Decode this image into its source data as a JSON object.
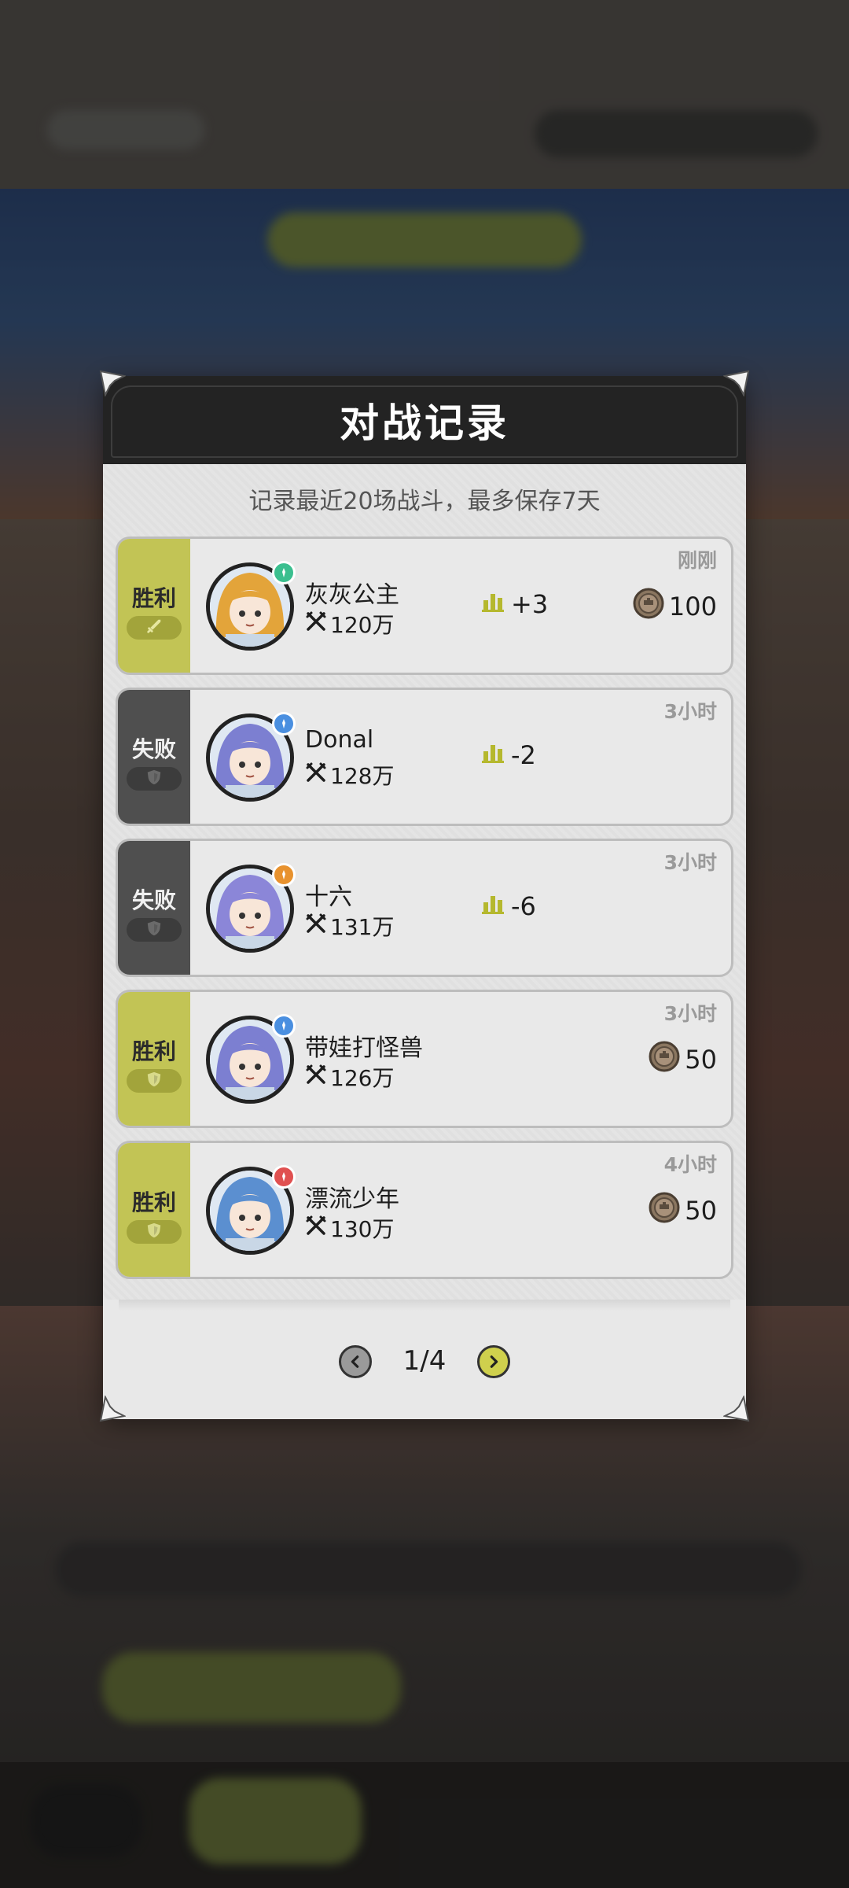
{
  "dialog": {
    "title": "对战记录",
    "subtitle": "记录最近20场战斗，最多保存7天"
  },
  "records": [
    {
      "result": "胜利",
      "outcome": "win",
      "icon": "sword-icon",
      "name": "灰灰公主",
      "power": "120万",
      "time": "刚刚",
      "rank_delta": "+3",
      "coins": "100",
      "avatar_color": "#e3a43a",
      "badge_color": "#3bbf8f"
    },
    {
      "result": "失败",
      "outcome": "lose",
      "icon": "shield-icon",
      "name": "Donal",
      "power": "128万",
      "time": "3小时",
      "rank_delta": "-2",
      "coins": null,
      "avatar_color": "#7c7fd1",
      "badge_color": "#4a8fe0"
    },
    {
      "result": "失败",
      "outcome": "lose",
      "icon": "shield-icon",
      "name": "十六",
      "power": "131万",
      "time": "3小时",
      "rank_delta": "-6",
      "coins": null,
      "avatar_color": "#8b86d8",
      "badge_color": "#e8922e"
    },
    {
      "result": "胜利",
      "outcome": "win",
      "icon": "shield-icon",
      "name": "带娃打怪兽",
      "power": "126万",
      "time": "3小时",
      "rank_delta": null,
      "coins": "50",
      "avatar_color": "#7c7fd1",
      "badge_color": "#4a8fe0"
    },
    {
      "result": "胜利",
      "outcome": "win",
      "icon": "shield-icon",
      "name": "漂流少年",
      "power": "130万",
      "time": "4小时",
      "rank_delta": null,
      "coins": "50",
      "avatar_color": "#5b8fd0",
      "badge_color": "#e05050"
    }
  ],
  "pager": {
    "label": "1/4"
  },
  "colors": {
    "win": "#c2c455",
    "lose": "#4f4f4f",
    "accent": "#cfd04d",
    "header": "#232323"
  }
}
